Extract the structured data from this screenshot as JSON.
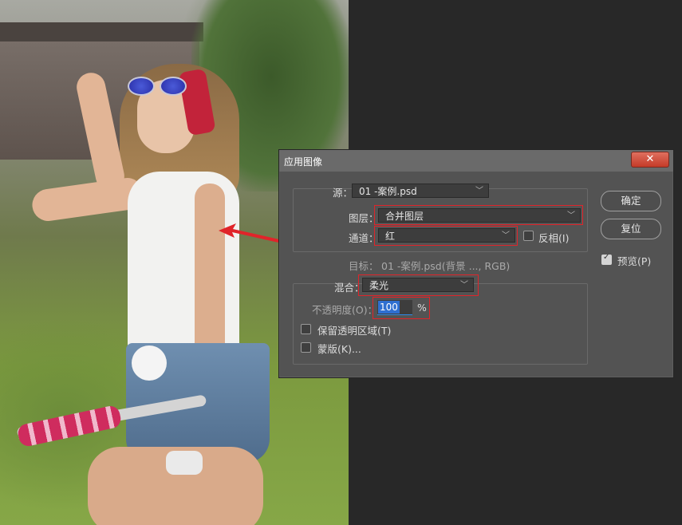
{
  "dialog": {
    "title": "应用图像",
    "close_glyph": "✕"
  },
  "source": {
    "label": "源：",
    "value": "01 -案例.psd"
  },
  "layer": {
    "label": "图层：",
    "value": "合并图层"
  },
  "channel": {
    "label": "通道：",
    "value": "红",
    "invert_label": "反相(I)",
    "invert_checked": false
  },
  "target": {
    "label": "目标：",
    "value": "01 -案例.psd(背景 ..., RGB)"
  },
  "blending": {
    "label": "混合：",
    "value": "柔光",
    "opacity_label": "不透明度(O)：",
    "opacity_value": "100",
    "opacity_unit": "%",
    "preserve_transparency_label": "保留透明区域(T)",
    "preserve_transparency_checked": false,
    "mask_label": "蒙版(K)...",
    "mask_checked": false
  },
  "buttons": {
    "ok": "确定",
    "reset": "复位",
    "preview_label": "预览(P)",
    "preview_checked": true
  },
  "colors": {
    "highlight_box": "#e0242a",
    "dialog_bg": "#535353",
    "app_bg": "#282828"
  }
}
